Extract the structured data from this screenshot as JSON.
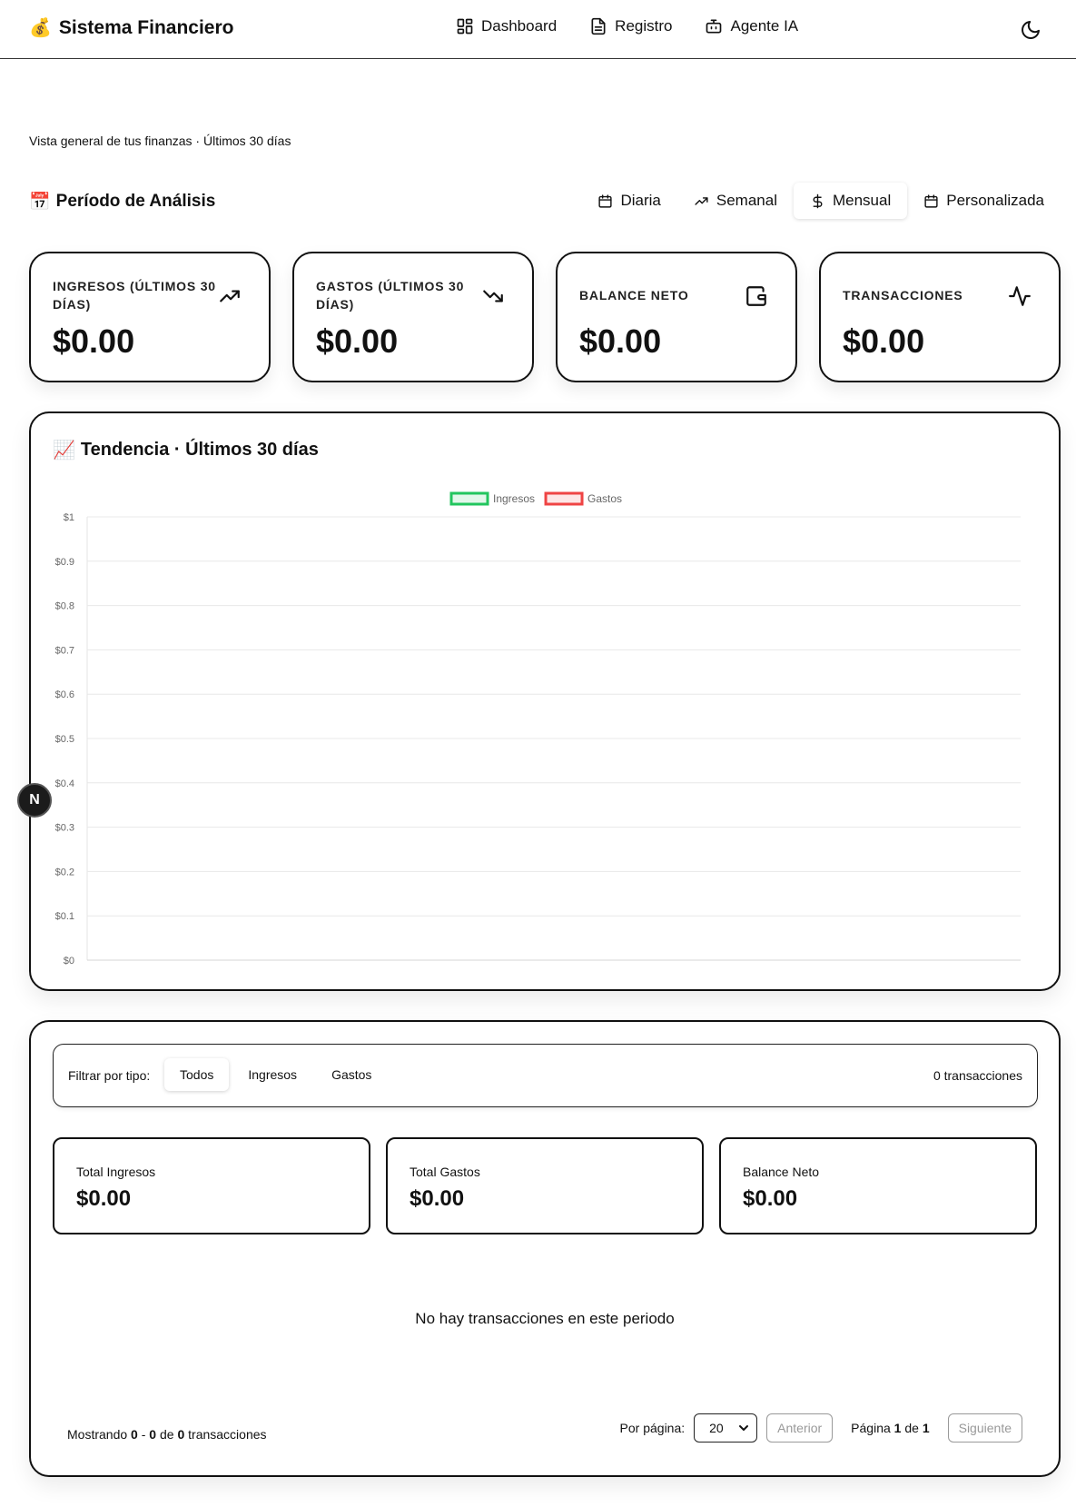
{
  "header": {
    "brand_emoji": "💰",
    "brand": "Sistema Financiero",
    "nav": [
      {
        "label": "Dashboard",
        "icon": "dashboard-icon"
      },
      {
        "label": "Registro",
        "icon": "file-text-icon"
      },
      {
        "label": "Agente IA",
        "icon": "bot-icon"
      }
    ],
    "theme_icon": "moon-icon"
  },
  "subtitle": "Vista general de tus finanzas · Últimos 30 días",
  "period": {
    "emoji": "📅",
    "title": "Período de Análisis",
    "buttons": [
      {
        "label": "Diaria",
        "icon": "calendar-icon"
      },
      {
        "label": "Semanal",
        "icon": "trending-up-icon"
      },
      {
        "label": "Mensual",
        "icon": "dollar-icon",
        "active": true
      },
      {
        "label": "Personalizada",
        "icon": "calendar-icon"
      }
    ]
  },
  "stats": [
    {
      "label": "INGRESOS (ÚLTIMOS 30 DÍAS)",
      "value": "$0.00",
      "icon": "trending-up-icon"
    },
    {
      "label": "GASTOS (ÚLTIMOS 30 DÍAS)",
      "value": "$0.00",
      "icon": "trending-down-icon"
    },
    {
      "label": "BALANCE NETO",
      "value": "$0.00",
      "icon": "wallet-icon"
    },
    {
      "label": "TRANSACCIONES",
      "value": "$0.00",
      "icon": "activity-icon"
    }
  ],
  "trend": {
    "emoji": "📈",
    "title": "Tendencia · Últimos 30 días"
  },
  "chart_data": {
    "type": "line",
    "title": "",
    "xlabel": "",
    "ylabel": "",
    "ylim": [
      0,
      1
    ],
    "yticks": [
      0,
      0.1,
      0.2,
      0.3,
      0.4,
      0.5,
      0.6,
      0.7,
      0.8,
      0.9,
      1
    ],
    "ytick_labels": [
      "$0",
      "$0.1",
      "$0.2",
      "$0.3",
      "$0.4",
      "$0.5",
      "$0.6",
      "$0.7",
      "$0.8",
      "$0.9",
      "$1"
    ],
    "grid": true,
    "legend": "top-center",
    "x": [],
    "series": [
      {
        "name": "Ingresos",
        "values": [],
        "color": "#22c55e"
      },
      {
        "name": "Gastos",
        "values": [],
        "color": "#ef4444"
      }
    ]
  },
  "badge": "N",
  "transactions": {
    "filter_label": "Filtrar por tipo:",
    "filters": [
      {
        "label": "Todos",
        "active": true
      },
      {
        "label": "Ingresos"
      },
      {
        "label": "Gastos"
      }
    ],
    "count": "0 transacciones",
    "summary": [
      {
        "label": "Total Ingresos",
        "value": "$0.00"
      },
      {
        "label": "Total Gastos",
        "value": "$0.00"
      },
      {
        "label": "Balance Neto",
        "value": "$0.00"
      }
    ],
    "empty": "No hay transacciones en este periodo",
    "pager": {
      "showing_prefix": "Mostrando",
      "from": "0",
      "to": "0",
      "total": "0",
      "dash": "-",
      "of": "de",
      "suffix": "transacciones",
      "per_page_label": "Por página:",
      "per_page": "20",
      "prev": "Anterior",
      "next": "Siguiente",
      "page_word": "Página",
      "page": "1",
      "pages": "1"
    }
  }
}
